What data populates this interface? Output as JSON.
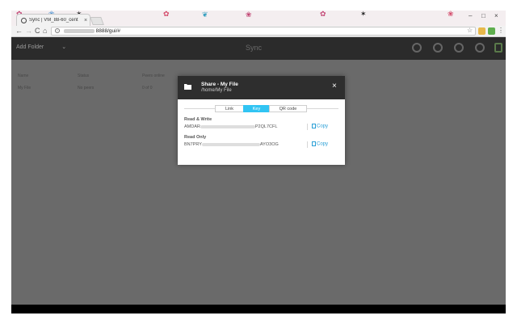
{
  "browser": {
    "tab_title": "Sync | VM_88-60_cent",
    "tab_close": "×",
    "url_suffix": "8888/gui/#",
    "nav": {
      "back": "←",
      "forward": "→",
      "reload": "C",
      "home": "⌂"
    },
    "window_controls": {
      "minimize": "–",
      "maximize": "□",
      "close": "×"
    },
    "star": "☆",
    "menu": "⋮"
  },
  "app": {
    "title": "Sync",
    "add_folder": "Add Folder",
    "add_folder_caret": "⌄",
    "columns": {
      "name": "Name",
      "status": "Status",
      "peers": "Peers online"
    },
    "row": {
      "name": "My File",
      "status": "No peers",
      "peers": "0 of 0"
    }
  },
  "dialog": {
    "title": "Share - My File",
    "subtitle": "/home/My File",
    "close": "×",
    "tabs": [
      {
        "label": "Link",
        "active": false
      },
      {
        "label": "Key",
        "active": true
      },
      {
        "label": "QR code",
        "active": false
      }
    ],
    "read_write": {
      "label": "Read & Write",
      "key_start": "AMDAR",
      "key_end": "P2QL7CFL",
      "copy": "Copy"
    },
    "read_only": {
      "label": "Read Only",
      "key_start": "BN7PRY",
      "key_end": "AYO3OG",
      "copy": "Copy"
    }
  },
  "colors": {
    "accent": "#31c4f3",
    "link": "#2a9fd6",
    "header": "#2e2e2e",
    "overlay": "#6a6a6a"
  },
  "icons": [
    "folder-icon",
    "close-icon",
    "copy-icon",
    "search-icon",
    "settings-icon",
    "star-icon"
  ]
}
